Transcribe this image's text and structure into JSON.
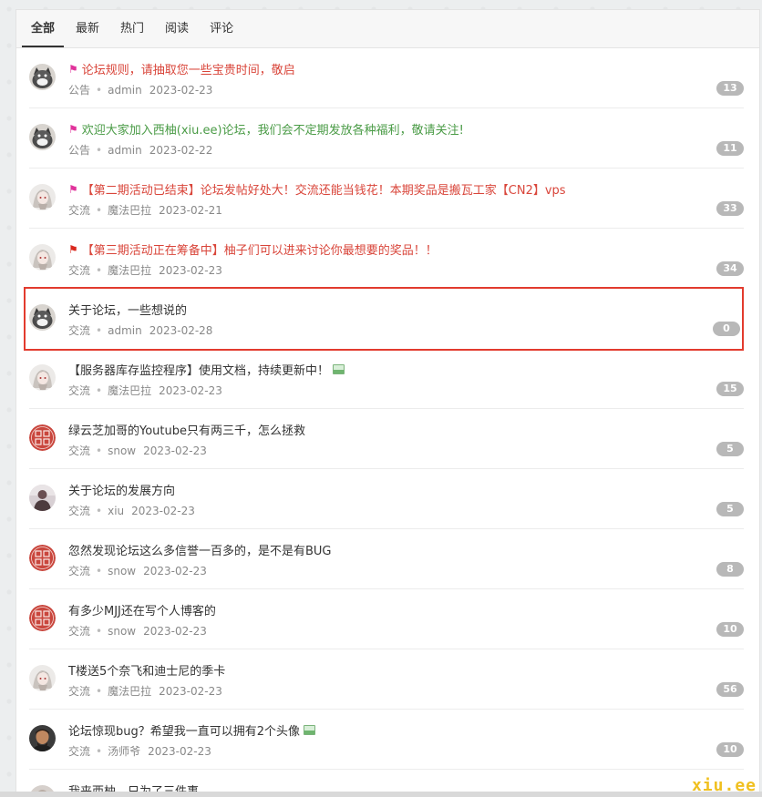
{
  "tabs": [
    "全部",
    "最新",
    "热门",
    "阅读",
    "评论"
  ],
  "active_tab": "全部",
  "colors": {
    "red": "#d9453a",
    "green": "#4a9b46",
    "pink_flag": "#e0339b",
    "red_flag": "#d9281e",
    "badge": "#b8b8b8",
    "highlight": "#e23b2e"
  },
  "rows": [
    {
      "flag": "pink",
      "title": "论坛规则，请抽取您一些宝贵时间，敬启",
      "title_color": "red",
      "category": "公告",
      "author": "admin",
      "date": "2023-02-23",
      "count": "13",
      "avatar": "cat"
    },
    {
      "flag": "pink",
      "title": "欢迎大家加入西柚(xiu.ee)论坛，我们会不定期发放各种福利，敬请关注!",
      "title_color": "green",
      "category": "公告",
      "author": "admin",
      "date": "2023-02-22",
      "count": "11",
      "avatar": "cat"
    },
    {
      "flag": "pink",
      "title": "【第二期活动已结束】论坛发帖好处大！交流还能当钱花！本期奖品是搬瓦工家【CN2】vps",
      "title_color": "red",
      "category": "交流",
      "author": "魔法巴拉",
      "date": "2023-02-21",
      "count": "33",
      "avatar": "anime"
    },
    {
      "flag": "red",
      "title": "【第三期活动正在筹备中】柚子们可以进来讨论你最想要的奖品！！",
      "title_color": "red",
      "category": "交流",
      "author": "魔法巴拉",
      "date": "2023-02-23",
      "count": "34",
      "avatar": "anime"
    },
    {
      "flag": "",
      "title": "关于论坛，一些想说的",
      "title_color": "",
      "category": "交流",
      "author": "admin",
      "date": "2023-02-28",
      "count": "0",
      "avatar": "cat",
      "highlight": true
    },
    {
      "flag": "",
      "title": "【服务器库存监控程序】使用文档，持续更新中！",
      "title_color": "",
      "image": true,
      "category": "交流",
      "author": "魔法巴拉",
      "date": "2023-02-23",
      "count": "15",
      "avatar": "anime"
    },
    {
      "flag": "",
      "title": "绿云芝加哥的Youtube只有两三千，怎么拯救",
      "title_color": "",
      "category": "交流",
      "author": "snow",
      "date": "2023-02-23",
      "count": "5",
      "avatar": "seal"
    },
    {
      "flag": "",
      "title": "关于论坛的发展方向",
      "title_color": "",
      "category": "交流",
      "author": "xiu",
      "date": "2023-02-23",
      "count": "5",
      "avatar": "person"
    },
    {
      "flag": "",
      "title": "忽然发现论坛这么多信誉一百多的，是不是有BUG",
      "title_color": "",
      "category": "交流",
      "author": "snow",
      "date": "2023-02-23",
      "count": "8",
      "avatar": "seal"
    },
    {
      "flag": "",
      "title": "有多少MJJ还在写个人博客的",
      "title_color": "",
      "category": "交流",
      "author": "snow",
      "date": "2023-02-23",
      "count": "10",
      "avatar": "seal"
    },
    {
      "flag": "",
      "title": "T楼送5个奈飞和迪士尼的季卡",
      "title_color": "",
      "category": "交流",
      "author": "魔法巴拉",
      "date": "2023-02-23",
      "count": "56",
      "avatar": "anime"
    },
    {
      "flag": "",
      "title": "论坛惊现bug？希望我一直可以拥有2个头像",
      "title_color": "",
      "image": true,
      "category": "交流",
      "author": "汤师爷",
      "date": "2023-02-23",
      "count": "10",
      "avatar": "man"
    },
    {
      "flag": "",
      "title": "我来西柚，只为了三件事",
      "title_color": "",
      "category": "",
      "author": "",
      "date": "",
      "count": "",
      "avatar": "generic"
    }
  ],
  "watermark": "xiu.ee"
}
